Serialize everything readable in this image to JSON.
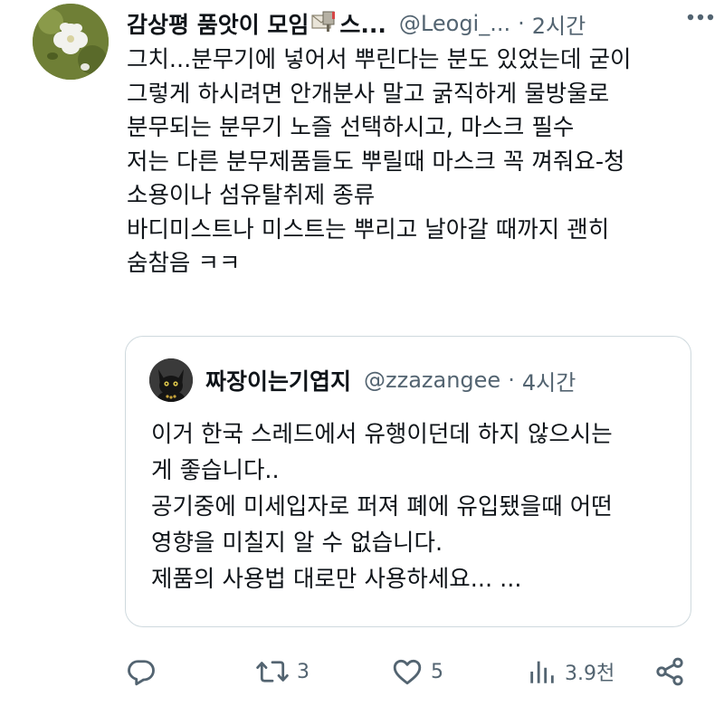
{
  "tweet": {
    "display_name": "감상평 품앗이 모임",
    "name_suffix": "스...",
    "handle": "@Leogi_...",
    "separator": "·",
    "time": "2시간",
    "text": "그치...분무기에 넣어서 뿌린다는 분도 있었는데 굳이\n그렇게 하시려면 안개분사 말고 굵직하게 물방울로\n분무되는 분무기 노즐 선택하시고, 마스크 필수\n저는 다른 분무제품들도 뿌릴때 마스크 꼭 껴줘요-청\n소용이나 섬유탈취제 종류\n바디미스트나 미스트는 뿌리고 날아갈 때까지 괜히\n숨참음 ㅋㅋ"
  },
  "quote": {
    "display_name": "짜장이는기엽지",
    "handle": "@zzazangee",
    "separator": "·",
    "time": "4시간",
    "text": "이거 한국 스레드에서 유행이던데 하지 않으시는\n게 좋습니다..\n공기중에 미세입자로 퍼져 폐에 유입됐을때 어떤\n영향을 미칠지 알 수 없습니다.\n제품의 사용법 대로만 사용하세요... ..."
  },
  "actions": {
    "reply_icon": "reply-icon",
    "retweet_icon": "retweet-icon",
    "retweet_count": "3",
    "like_icon": "heart-icon",
    "like_count": "5",
    "views_icon": "analytics-icon",
    "views_count": "3.9천",
    "share_icon": "share-icon"
  },
  "colors": {
    "text": "#0f1419",
    "secondary": "#536471",
    "border": "#cfd9de"
  }
}
